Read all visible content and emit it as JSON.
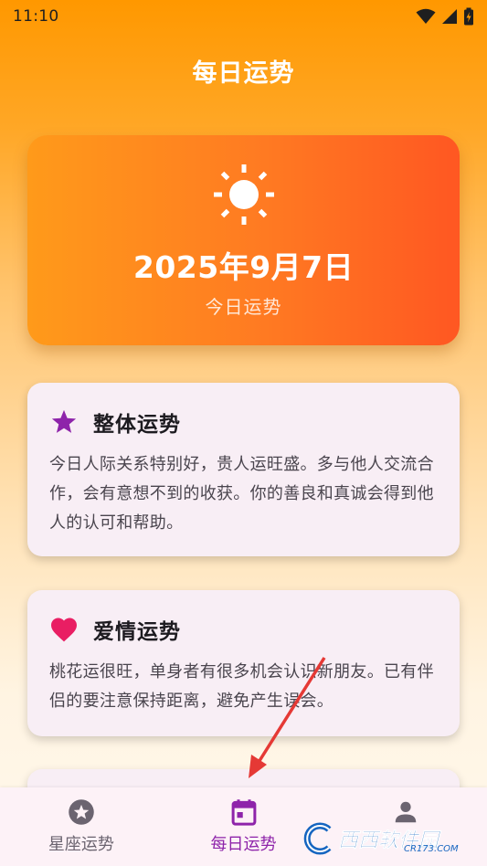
{
  "status_bar": {
    "time": "11:10"
  },
  "header": {
    "title": "每日运势"
  },
  "date_card": {
    "date": "2025年9月7日",
    "subtitle": "今日运势",
    "icon": "sun-icon"
  },
  "cards": [
    {
      "title": "整体运势",
      "icon": "star-icon",
      "icon_color": "#8E24AA",
      "body": "今日人际关系特别好，贵人运旺盛。多与他人交流合作，会有意想不到的收获。你的善良和真诚会得到他人的认可和帮助。"
    },
    {
      "title": "爱情运势",
      "icon": "heart-icon",
      "icon_color": "#E91E63",
      "body": "桃花运很旺，单身者有很多机会认识新朋友。已有伴侣的要注意保持距离，避免产生误会。"
    }
  ],
  "bottom_nav": {
    "items": [
      {
        "label": "星座运势",
        "icon": "star-circle-icon",
        "active": false
      },
      {
        "label": "每日运势",
        "icon": "calendar-icon",
        "active": true
      },
      {
        "label": "",
        "icon": "person-icon",
        "active": false
      }
    ]
  },
  "watermark": {
    "text": "西西软件园",
    "sub": "CR173.COM"
  },
  "colors": {
    "accent": "#8E24AA",
    "orange": "#FF9800",
    "heart": "#E91E63"
  }
}
